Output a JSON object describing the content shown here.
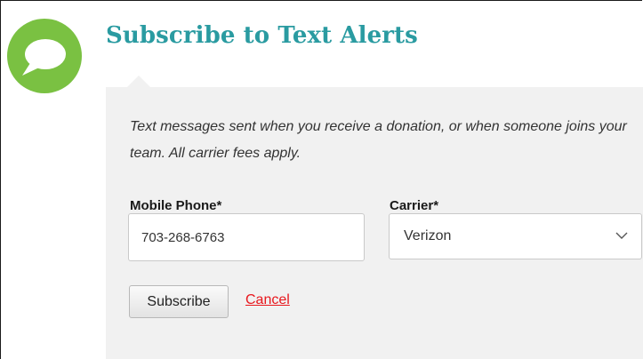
{
  "header": {
    "title": "Subscribe to Text Alerts",
    "icon": "chat-bubble-icon"
  },
  "form": {
    "description": "Text messages sent when you receive a donation, or when someone joins your team. All carrier fees apply.",
    "mobile_phone": {
      "label": "Mobile Phone*",
      "value": "703-268-6763"
    },
    "carrier": {
      "label": "Carrier*",
      "selected": "Verizon",
      "icon": "chevron-down-icon"
    },
    "subscribe_label": "Subscribe",
    "cancel_label": "Cancel"
  },
  "colors": {
    "title": "#2a9ba1",
    "badge": "#7ac142",
    "panel": "#f1f1f1",
    "cancel_link": "#e8171d"
  }
}
